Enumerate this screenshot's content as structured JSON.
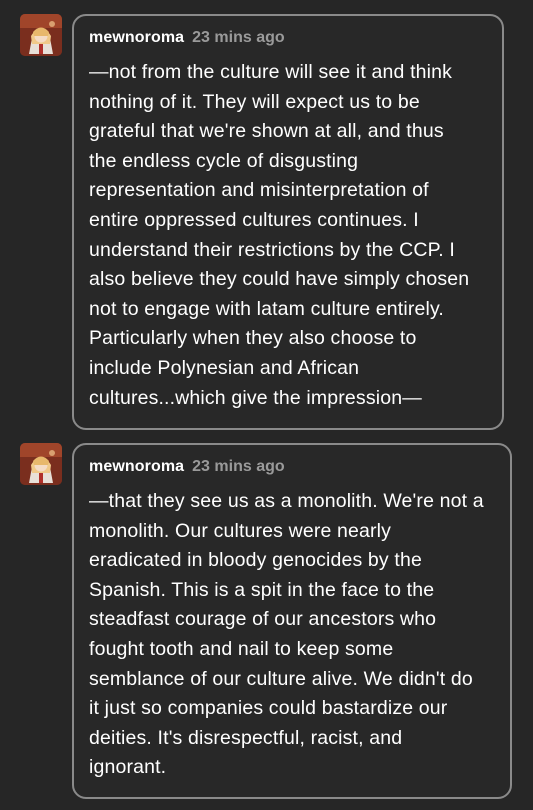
{
  "comments": [
    {
      "username": "mewnoroma",
      "timestamp": "23 mins ago",
      "avatar_icon": "anime-character-avatar-icon",
      "text": "—not from the culture will see it and think\nnothing of it. They will expect us to be\ngrateful that we're shown at all, and thus\nthe endless cycle of disgusting\nrepresentation and misinterpretation of\nentire oppressed cultures continues. I\nunderstand their restrictions by the CCP. I\nalso believe they could have simply chosen\nnot to engage with latam culture entirely.\nParticularly when they also choose to\ninclude Polynesian and African\ncultures...which give the impression—"
    },
    {
      "username": "mewnoroma",
      "timestamp": "23 mins ago",
      "avatar_icon": "anime-character-avatar-icon",
      "text": "—that they see us as a monolith. We're not a\nmonolith. Our cultures were nearly\neradicated in bloody genocides by the\nSpanish. This is a spit in the face to the\nsteadfast courage of our ancestors who\nfought tooth and nail to keep some\nsemblance of our culture alive. We didn't do\nit just so companies could bastardize our\ndeities. It's disrespectful, racist, and\nignorant."
    }
  ],
  "colors": {
    "background": "#262626",
    "bubble_border": "#8a8a8a",
    "text": "#ffffff",
    "timestamp": "#9a9a9a"
  }
}
